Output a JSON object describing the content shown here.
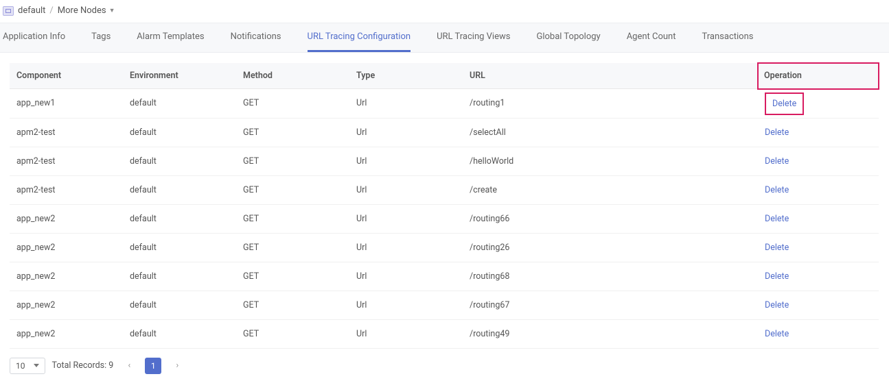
{
  "breadcrumb": {
    "root": "default",
    "more": "More Nodes"
  },
  "tabs": [
    {
      "label": "Application Info",
      "active": false
    },
    {
      "label": "Tags",
      "active": false
    },
    {
      "label": "Alarm Templates",
      "active": false
    },
    {
      "label": "Notifications",
      "active": false
    },
    {
      "label": "URL Tracing Configuration",
      "active": true
    },
    {
      "label": "URL Tracing Views",
      "active": false
    },
    {
      "label": "Global Topology",
      "active": false
    },
    {
      "label": "Agent Count",
      "active": false
    },
    {
      "label": "Transactions",
      "active": false
    }
  ],
  "table": {
    "headers": {
      "component": "Component",
      "environment": "Environment",
      "method": "Method",
      "type": "Type",
      "url": "URL",
      "operation": "Operation"
    },
    "delete_label": "Delete",
    "rows": [
      {
        "component": "app_new1",
        "environment": "default",
        "method": "GET",
        "type": "Url",
        "url": "/routing1",
        "highlight": true
      },
      {
        "component": "apm2-test",
        "environment": "default",
        "method": "GET",
        "type": "Url",
        "url": "/selectAll",
        "highlight": false
      },
      {
        "component": "apm2-test",
        "environment": "default",
        "method": "GET",
        "type": "Url",
        "url": "/helloWorld",
        "highlight": false
      },
      {
        "component": "apm2-test",
        "environment": "default",
        "method": "GET",
        "type": "Url",
        "url": "/create",
        "highlight": false
      },
      {
        "component": "app_new2",
        "environment": "default",
        "method": "GET",
        "type": "Url",
        "url": "/routing66",
        "highlight": false
      },
      {
        "component": "app_new2",
        "environment": "default",
        "method": "GET",
        "type": "Url",
        "url": "/routing26",
        "highlight": false
      },
      {
        "component": "app_new2",
        "environment": "default",
        "method": "GET",
        "type": "Url",
        "url": "/routing68",
        "highlight": false
      },
      {
        "component": "app_new2",
        "environment": "default",
        "method": "GET",
        "type": "Url",
        "url": "/routing67",
        "highlight": false
      },
      {
        "component": "app_new2",
        "environment": "default",
        "method": "GET",
        "type": "Url",
        "url": "/routing49",
        "highlight": false
      }
    ]
  },
  "pagination": {
    "page_size": "10",
    "total_label": "Total Records: 9",
    "current_page": "1"
  }
}
